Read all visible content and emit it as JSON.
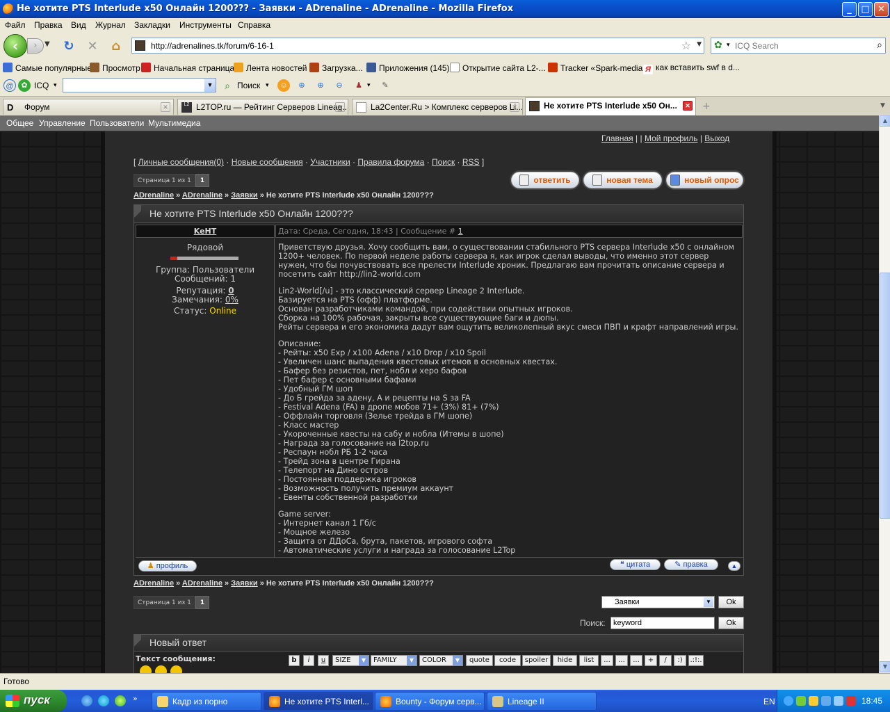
{
  "window": {
    "title": "Не хотите PTS Interlude x50 Онлайн 1200??? - Заявки - ADrenaline - ADrenaline - Mozilla Firefox",
    "buttons": {
      "minimize": "_",
      "maximize": "□",
      "close": "✕"
    }
  },
  "menu": [
    "Файл",
    "Правка",
    "Вид",
    "Журнал",
    "Закладки",
    "Инструменты",
    "Справка"
  ],
  "nav": {
    "url": "http://adrenalines.tk/forum/6-16-1",
    "search_placeholder": "ICQ Search"
  },
  "bookmarks": [
    {
      "label": "Самые популярные",
      "color": "#3a6fd8"
    },
    {
      "label": "Просмотр",
      "color": "#8b5a2b"
    },
    {
      "label": "Начальная страница",
      "color": "#cc2222"
    },
    {
      "label": "Лента новостей",
      "color": "#f0a020"
    },
    {
      "label": "Загрузка...",
      "color": "#b04010"
    },
    {
      "label": "Приложения (145)",
      "color": "#3b5998"
    },
    {
      "label": "Открытие сайта L2-...",
      "color": "#dddddd"
    },
    {
      "label": "Tracker «Spark-media»",
      "color": "#cc3300"
    },
    {
      "label": "как вставить swf в d...",
      "color": "#ee2222"
    }
  ],
  "icqbar": {
    "icq_label": "ICQ",
    "search_label": "Поиск"
  },
  "tabs": [
    {
      "label": "Форум"
    },
    {
      "label": "L2TOP.ru — Рейтинг Серверов Lineag..."
    },
    {
      "label": "La2Center.Ru > Комплекс серверов Li..."
    },
    {
      "label": "Не хотите PTS Interlude x50 Он..."
    }
  ],
  "site": {
    "nav": [
      "Общее",
      "Управление",
      "Пользователи",
      "Мультимедиа"
    ],
    "toplinks": {
      "home": "Главная",
      "profile": "Мой профиль",
      "logout": "Выход"
    },
    "forumlinks": {
      "pm": "Личные сообщения(0)",
      "new": "Новые сообщения",
      "members": "Участники",
      "rules": "Правила форума",
      "search": "Поиск",
      "rss": "RSS"
    },
    "pager": {
      "label": "Страница 1 из 1",
      "page": "1"
    },
    "buttons": {
      "reply": "ответить",
      "new_topic": "новая тема",
      "new_poll": "новый опрос"
    },
    "breadcrumbs": [
      "ADrenaline",
      "ADrenaline",
      "Заявки",
      "Не хотите PTS Interlude x50 Онлайн 1200???"
    ],
    "topic_title": "Не хотите PTS Interlude x50 Онлайн 1200???"
  },
  "post": {
    "author": "KeHT",
    "date_line": "Дата: Среда, Сегодня, 18:43 | Сообщение #",
    "post_number": "1",
    "rank": "Рядовой",
    "group": "Группа: Пользователи",
    "messages": "Сообщений: 1",
    "reputation_label": "Репутация:",
    "reputation_value": "0",
    "warnings_label": "Замечания:",
    "warnings_value": "0%",
    "status_label": "Статус:",
    "status_value": "Online",
    "paragraphs": [
      [
        "Приветствую друзья. Хочу сообщить вам, о существовании стабильного PTS сервера Interlude x50 с онлайном 1200+ человек. По первой неделе работы сервера я, как игрок сделал выводы, что именно этот сервер нужен, что бы почувствовать все прелести Interlude хроник. Предлагаю вам прочитать описание сервера и посетить сайт http://lin2-world.com"
      ],
      [
        "Lin2-World[/u] - это классический сервер Lineage 2 Interlude.",
        "Базируется на PTS (офф) платформе.",
        "Основан разработчиками командой, при содействии опытных игроков.",
        "Сборка на 100% рабочая, закрыты все существующие баги и дюпы.",
        "Рейты сервера и его экономика дадут вам ощутить великолепный вкус смеси ПВП и крафт направлений игры."
      ],
      [
        "Описание:",
        "- Рейты: x50 Exp / x100 Adena / x10 Drop / x10 Spoil",
        "- Увеличен шанс выпадения квестовых итемов в основных квестах.",
        "- Бафер без резистов, пет, нобл и херо бафов",
        "- Пет бафер с основными бафами",
        "- Удобный ГМ шоп",
        "- До Б грейда за адену, А и рецепты на S за FA",
        "- Festival Adena (FA) в дропе мобов 71+ (3%) 81+ (7%)",
        "- Оффлайн торговля (Зелье трейда в ГМ шопе)",
        "- Класс мастер",
        "- Укороченные квесты на сабу и нобла (Итемы в шопе)",
        "- Награда за голосование на l2top.ru",
        "- Респаун нобл РБ 1-2 часа",
        "- Трейд зона в центре Гирана",
        "- Телепорт на Дино остров",
        "- Постоянная поддержка игроков",
        "- Возможность получить премиум аккаунт",
        "- Евенты собственной разработки"
      ],
      [
        "Game server:",
        "- Интернет канал 1 Гб/с",
        "- Мощное железо",
        "- Защита от ДДоСа, брута, пакетов, игрового софта",
        "- Автоматические услуги и награда за голосование L2Top"
      ]
    ],
    "btn_profile": "профиль",
    "btn_quote": "цитата",
    "btn_edit": "правка"
  },
  "bottom": {
    "jump_select": "Заявки",
    "ok": "Ok",
    "search_label": "Поиск:",
    "search_value": "keyword"
  },
  "reply": {
    "title": "Новый ответ",
    "text_label": "Текст сообщения:",
    "editor_buttons": [
      "b",
      "i",
      "u",
      "SIZE",
      "FAMILY",
      "COLOR",
      "quote",
      "code",
      "spoiler",
      "hide",
      "list",
      "...",
      "...",
      "...",
      "+",
      "/",
      ":)",
      ".:!:."
    ]
  },
  "status": "Готово",
  "taskbar": {
    "start": "пуск",
    "items": [
      "Кадр из порно",
      "Не хотите PTS Interl...",
      "Bounty - Форум серв...",
      "Lineage II"
    ],
    "lang": "EN",
    "clock": "18:45"
  }
}
